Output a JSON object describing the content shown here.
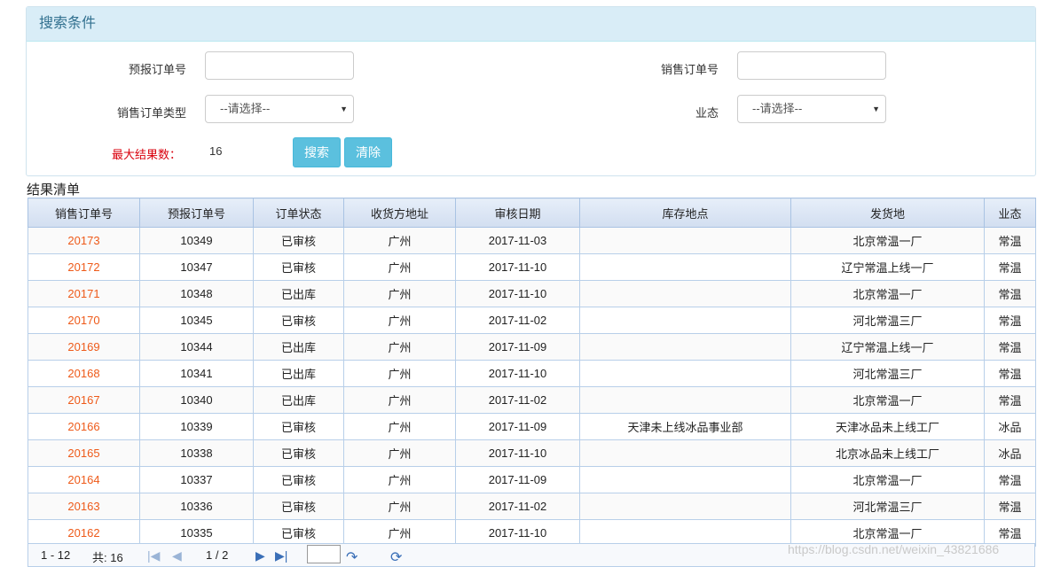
{
  "panel": {
    "title": "搜索条件"
  },
  "form": {
    "prereport_no_label": "预报订单号",
    "sales_no_label": "销售订单号",
    "sales_type_label": "销售订单类型",
    "sales_type_value": "--请选择--",
    "business_label": "业态",
    "business_value": "--请选择--",
    "max_results_label": "最大结果数：",
    "max_results_value": "16",
    "search_label": "搜索",
    "clear_label": "清除"
  },
  "results": {
    "title": "结果清单",
    "columns": [
      "销售订单号",
      "预报订单号",
      "订单状态",
      "收货方地址",
      "审核日期",
      "库存地点",
      "发货地",
      "业态"
    ],
    "rows": [
      [
        "20173",
        "10349",
        "已审核",
        "广州",
        "2017-11-03",
        "",
        "北京常温一厂",
        "常温"
      ],
      [
        "20172",
        "10347",
        "已审核",
        "广州",
        "2017-11-10",
        "",
        "辽宁常温上线一厂",
        "常温"
      ],
      [
        "20171",
        "10348",
        "已出库",
        "广州",
        "2017-11-10",
        "",
        "北京常温一厂",
        "常温"
      ],
      [
        "20170",
        "10345",
        "已审核",
        "广州",
        "2017-11-02",
        "",
        "河北常温三厂",
        "常温"
      ],
      [
        "20169",
        "10344",
        "已出库",
        "广州",
        "2017-11-09",
        "",
        "辽宁常温上线一厂",
        "常温"
      ],
      [
        "20168",
        "10341",
        "已出库",
        "广州",
        "2017-11-10",
        "",
        "河北常温三厂",
        "常温"
      ],
      [
        "20167",
        "10340",
        "已出库",
        "广州",
        "2017-11-02",
        "",
        "北京常温一厂",
        "常温"
      ],
      [
        "20166",
        "10339",
        "已审核",
        "广州",
        "2017-11-09",
        "天津未上线冰品事业部",
        "天津冰品未上线工厂",
        "冰品"
      ],
      [
        "20165",
        "10338",
        "已审核",
        "广州",
        "2017-11-10",
        "",
        "北京冰品未上线工厂",
        "冰品"
      ],
      [
        "20164",
        "10337",
        "已审核",
        "广州",
        "2017-11-09",
        "",
        "北京常温一厂",
        "常温"
      ],
      [
        "20163",
        "10336",
        "已审核",
        "广州",
        "2017-11-02",
        "",
        "河北常温三厂",
        "常温"
      ],
      [
        "20162",
        "10335",
        "已审核",
        "广州",
        "2017-11-10",
        "",
        "北京常温一厂",
        "常温"
      ]
    ]
  },
  "pager": {
    "range": "1 - 12",
    "total": "共: 16",
    "page": "1 / 2"
  },
  "watermark": "https://blog.csdn.net/weixin_43821686",
  "colors": {
    "accent": "#5bc0de",
    "link": "#ee5a19",
    "header_bg": "#d9edf7"
  }
}
